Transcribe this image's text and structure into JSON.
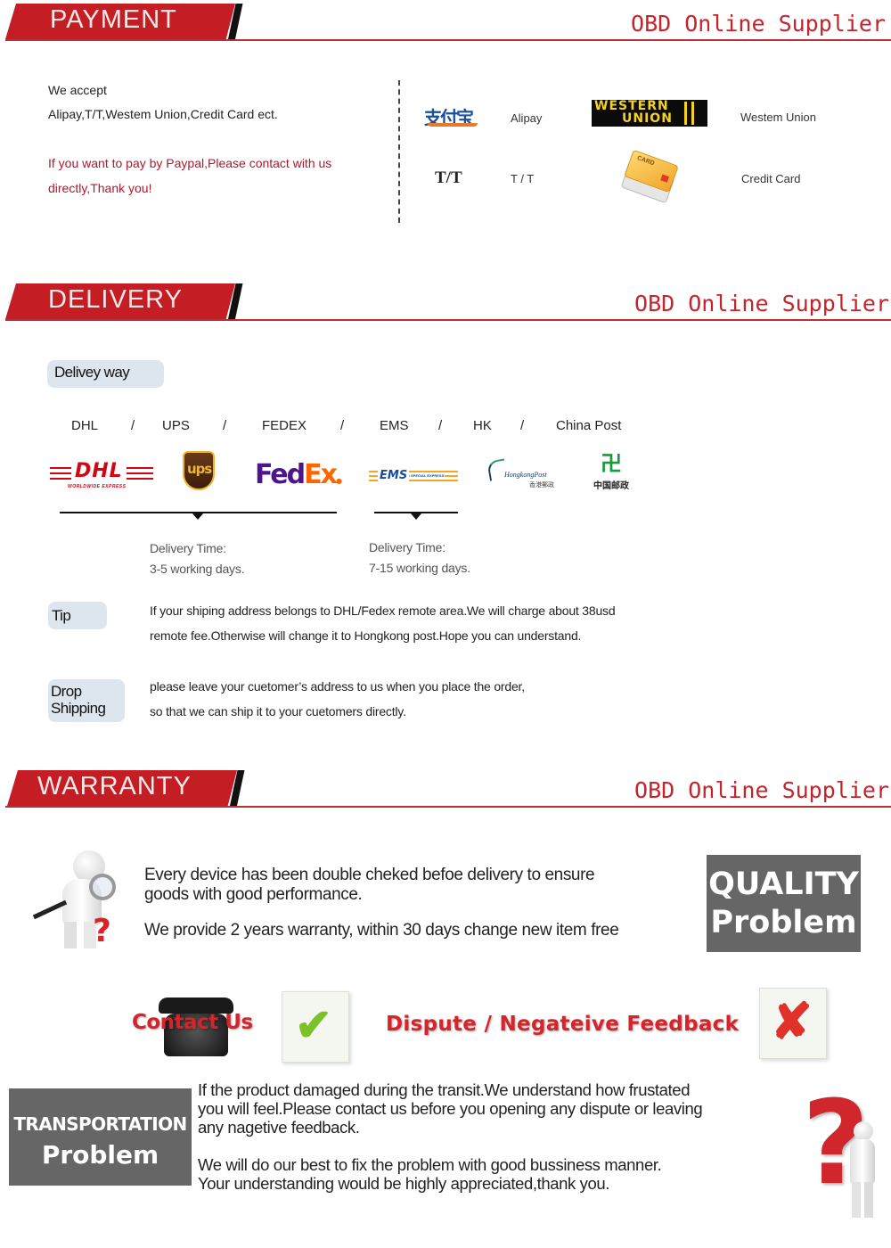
{
  "brand": "OBD Online Supplier",
  "colors": {
    "accent_red": "#c41d24",
    "brand_red": "#c4242c",
    "gray_box": "#666666",
    "pill_bg": "#dde5ee"
  },
  "payment": {
    "title": "PAYMENT",
    "accept_heading": "We accept",
    "accept_methods": "Alipay,T/T,Westem Union,Credit Card ect.",
    "paypal_note_line1": "If you want to pay by Paypal,Please contact with us",
    "paypal_note_line2": "directly,Thank you!",
    "methods": [
      {
        "logo": "支付宝",
        "icon": "alipay-logo",
        "label": "Alipay"
      },
      {
        "logo_line1": "WESTERN",
        "logo_line2": "UNION",
        "icon": "western-union-logo",
        "label": "Westem Union"
      },
      {
        "logo": "T/T",
        "icon": "tt-logo",
        "label": "T / T"
      },
      {
        "logo": "CARD",
        "icon": "credit-card-icon",
        "label": "Credit Card"
      }
    ]
  },
  "delivery": {
    "title": "DELIVERY",
    "way_label": "Delivey way",
    "carriers": [
      "DHL",
      "UPS",
      "FEDEX",
      "EMS",
      "HK",
      "China Post"
    ],
    "separator": "/",
    "logos": {
      "dhl": "DHL",
      "dhl_sub": "WORLDWIDE EXPRESS",
      "ups": "ups",
      "fedex_a": "Fed",
      "fedex_b": "Ex",
      "ems": "EMS",
      "ems_sub": "SPECIAL EXPRESS",
      "hk": "HongkongPost",
      "hk_sub": "香港郵政",
      "china_post": "中国邮政"
    },
    "groups": [
      {
        "time_label": "Delivery Time:",
        "time_value": "3-5 working days."
      },
      {
        "time_label": "Delivery Time:",
        "time_value": "7-15 working days."
      }
    ],
    "tip_label": "Tip",
    "tip_line1": "If your shiping address belongs to DHL/Fedex remote area.We will charge about 38usd",
    "tip_line2": "remote fee.Otherwise will change it to Hongkong post.Hope you can understand.",
    "drop_label_line1": "Drop",
    "drop_label_line2": "Shipping",
    "drop_line1": "please leave your cuetomer’s address to us when you place the order,",
    "drop_line2": "so that we can ship it to your cuetomers directly."
  },
  "warranty": {
    "title": "WARRANTY",
    "check_line1": "Every device has been double cheked befoe delivery to ensure",
    "check_line2": "goods with good performance.",
    "warranty_line": "We provide 2 years warranty, within 30 days change new item free",
    "quality_box_line1": "QUALITY",
    "quality_box_line2": "Problem",
    "contact_us": "Contact Us",
    "dispute": "Dispute / Negateive Feedback",
    "transport_box_line1": "TRANSPORTATION",
    "transport_box_line2": "Problem",
    "transport_line1": "If the product damaged during the transit.We understand how frustated",
    "transport_line2": "you will feel.Please contact us before you opening any dispute or leaving",
    "transport_line3": "any nagetive feedback.",
    "transport_line4": "We will do our best to fix the problem with good bussiness manner.",
    "transport_line5": "Your understanding would be highly appreciated,thank you."
  }
}
